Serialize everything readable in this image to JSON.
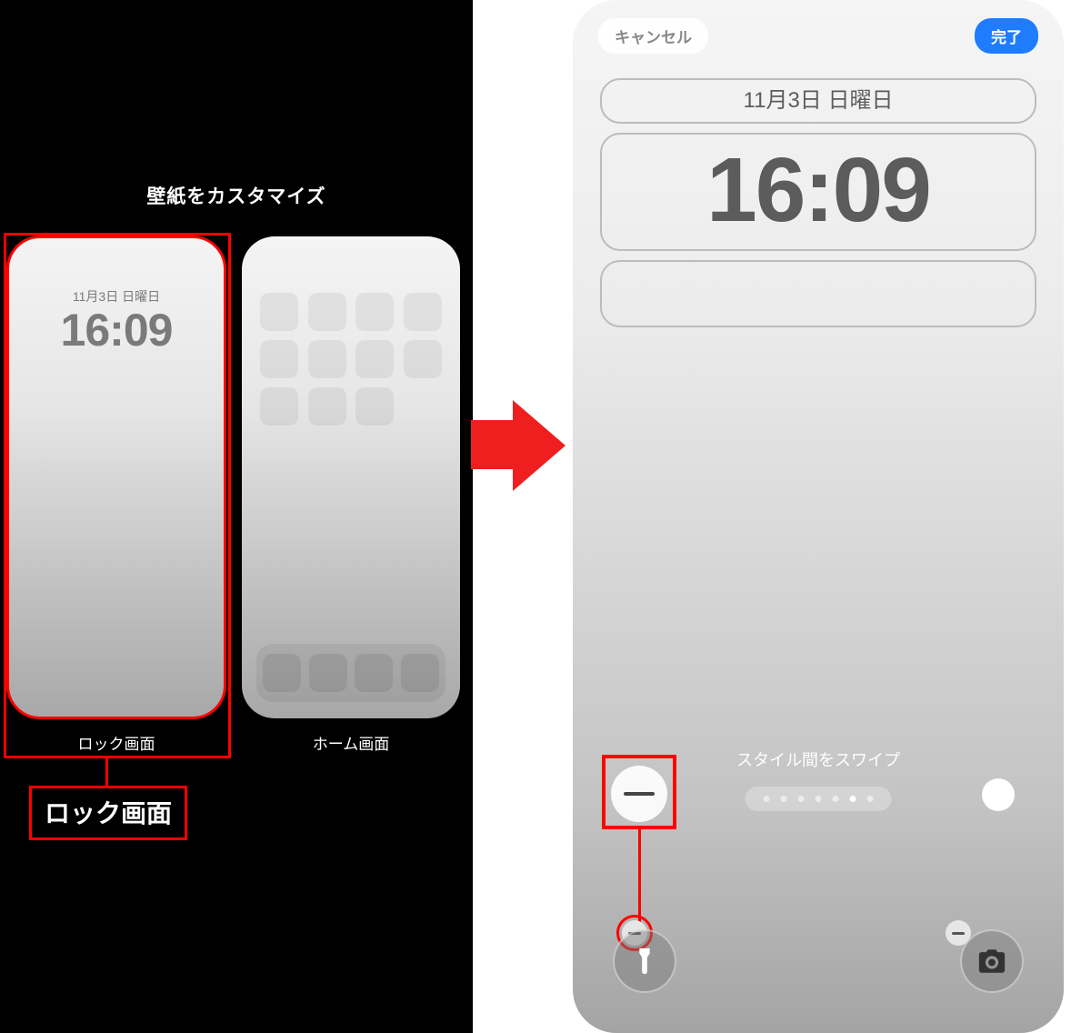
{
  "left": {
    "title": "壁紙をカスタマイズ",
    "lock_thumb": {
      "date": "11月3日 日曜日",
      "time": "16:09",
      "label": "ロック画面"
    },
    "home_thumb": {
      "label": "ホーム画面"
    },
    "callout": "ロック画面"
  },
  "right": {
    "cancel": "キャンセル",
    "done": "完了",
    "date": "11月3日 日曜日",
    "time": "16:09",
    "swipe_hint": "スタイル間をスワイプ",
    "page_count": 7,
    "page_active_index": 5,
    "icons": {
      "remove": "remove-minus-icon",
      "flashlight": "flashlight-icon",
      "camera": "camera-icon"
    }
  }
}
